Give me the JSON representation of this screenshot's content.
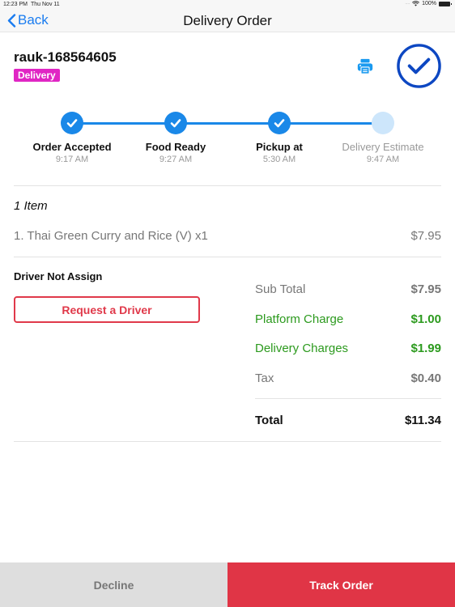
{
  "status_bar": {
    "time": "12:23 PM",
    "date": "Thu Nov 11",
    "battery": "100%"
  },
  "nav": {
    "back_label": "Back",
    "title": "Delivery Order"
  },
  "order": {
    "id": "rauk-168564605",
    "type_badge": "Delivery",
    "badge_color": "#e026c4",
    "print_icon": "printer-icon",
    "confirm_icon": "check-circle-icon"
  },
  "steps": [
    {
      "label": "Order Accepted",
      "time": "9:17 AM",
      "done": true
    },
    {
      "label": "Food Ready",
      "time": "9:27 AM",
      "done": true
    },
    {
      "label": "Pickup at",
      "time": "5:30 AM",
      "done": true
    },
    {
      "label": "Delivery Estimate",
      "time": "9:47 AM",
      "done": false
    }
  ],
  "items": {
    "count_label": "1 Item",
    "list": [
      {
        "name": "1. Thai Green Curry and Rice (V) x1",
        "price": "$7.95"
      }
    ]
  },
  "driver": {
    "status": "Driver Not Assign",
    "request_label": "Request a Driver"
  },
  "summary": {
    "rows": [
      {
        "label": "Sub Total",
        "value": "$7.95",
        "highlight": false
      },
      {
        "label": "Platform Charge",
        "value": "$1.00",
        "highlight": true
      },
      {
        "label": "Delivery Charges",
        "value": "$1.99",
        "highlight": true
      },
      {
        "label": "Tax",
        "value": "$0.40",
        "highlight": false
      }
    ],
    "total_label": "Total",
    "total_value": "$11.34"
  },
  "footer": {
    "decline_label": "Decline",
    "track_label": "Track Order"
  },
  "colors": {
    "accent_blue": "#1a88e8",
    "green": "#2c9a1e",
    "red": "#e03546"
  }
}
